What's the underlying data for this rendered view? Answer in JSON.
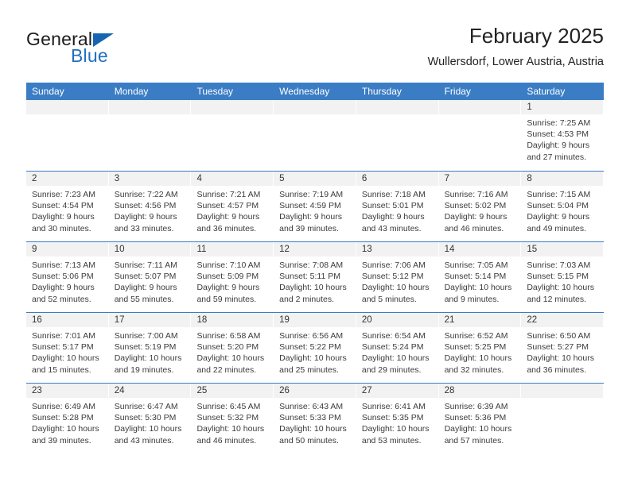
{
  "brand": {
    "name_primary": "General",
    "name_secondary": "Blue",
    "accent_color": "#1565b0"
  },
  "header": {
    "title": "February 2025",
    "subtitle": "Wullersdorf, Lower Austria, Austria"
  },
  "calendar": {
    "header_bg": "#3b7dc4",
    "daynum_bg": "#f2f2f2",
    "weekday_headers": [
      "Sunday",
      "Monday",
      "Tuesday",
      "Wednesday",
      "Thursday",
      "Friday",
      "Saturday"
    ],
    "weeks": [
      [
        {
          "date": "",
          "sunrise": "",
          "sunset": "",
          "daylight_line1": "",
          "daylight_line2": ""
        },
        {
          "date": "",
          "sunrise": "",
          "sunset": "",
          "daylight_line1": "",
          "daylight_line2": ""
        },
        {
          "date": "",
          "sunrise": "",
          "sunset": "",
          "daylight_line1": "",
          "daylight_line2": ""
        },
        {
          "date": "",
          "sunrise": "",
          "sunset": "",
          "daylight_line1": "",
          "daylight_line2": ""
        },
        {
          "date": "",
          "sunrise": "",
          "sunset": "",
          "daylight_line1": "",
          "daylight_line2": ""
        },
        {
          "date": "",
          "sunrise": "",
          "sunset": "",
          "daylight_line1": "",
          "daylight_line2": ""
        },
        {
          "date": "1",
          "sunrise": "Sunrise: 7:25 AM",
          "sunset": "Sunset: 4:53 PM",
          "daylight_line1": "Daylight: 9 hours",
          "daylight_line2": "and 27 minutes."
        }
      ],
      [
        {
          "date": "2",
          "sunrise": "Sunrise: 7:23 AM",
          "sunset": "Sunset: 4:54 PM",
          "daylight_line1": "Daylight: 9 hours",
          "daylight_line2": "and 30 minutes."
        },
        {
          "date": "3",
          "sunrise": "Sunrise: 7:22 AM",
          "sunset": "Sunset: 4:56 PM",
          "daylight_line1": "Daylight: 9 hours",
          "daylight_line2": "and 33 minutes."
        },
        {
          "date": "4",
          "sunrise": "Sunrise: 7:21 AM",
          "sunset": "Sunset: 4:57 PM",
          "daylight_line1": "Daylight: 9 hours",
          "daylight_line2": "and 36 minutes."
        },
        {
          "date": "5",
          "sunrise": "Sunrise: 7:19 AM",
          "sunset": "Sunset: 4:59 PM",
          "daylight_line1": "Daylight: 9 hours",
          "daylight_line2": "and 39 minutes."
        },
        {
          "date": "6",
          "sunrise": "Sunrise: 7:18 AM",
          "sunset": "Sunset: 5:01 PM",
          "daylight_line1": "Daylight: 9 hours",
          "daylight_line2": "and 43 minutes."
        },
        {
          "date": "7",
          "sunrise": "Sunrise: 7:16 AM",
          "sunset": "Sunset: 5:02 PM",
          "daylight_line1": "Daylight: 9 hours",
          "daylight_line2": "and 46 minutes."
        },
        {
          "date": "8",
          "sunrise": "Sunrise: 7:15 AM",
          "sunset": "Sunset: 5:04 PM",
          "daylight_line1": "Daylight: 9 hours",
          "daylight_line2": "and 49 minutes."
        }
      ],
      [
        {
          "date": "9",
          "sunrise": "Sunrise: 7:13 AM",
          "sunset": "Sunset: 5:06 PM",
          "daylight_line1": "Daylight: 9 hours",
          "daylight_line2": "and 52 minutes."
        },
        {
          "date": "10",
          "sunrise": "Sunrise: 7:11 AM",
          "sunset": "Sunset: 5:07 PM",
          "daylight_line1": "Daylight: 9 hours",
          "daylight_line2": "and 55 minutes."
        },
        {
          "date": "11",
          "sunrise": "Sunrise: 7:10 AM",
          "sunset": "Sunset: 5:09 PM",
          "daylight_line1": "Daylight: 9 hours",
          "daylight_line2": "and 59 minutes."
        },
        {
          "date": "12",
          "sunrise": "Sunrise: 7:08 AM",
          "sunset": "Sunset: 5:11 PM",
          "daylight_line1": "Daylight: 10 hours",
          "daylight_line2": "and 2 minutes."
        },
        {
          "date": "13",
          "sunrise": "Sunrise: 7:06 AM",
          "sunset": "Sunset: 5:12 PM",
          "daylight_line1": "Daylight: 10 hours",
          "daylight_line2": "and 5 minutes."
        },
        {
          "date": "14",
          "sunrise": "Sunrise: 7:05 AM",
          "sunset": "Sunset: 5:14 PM",
          "daylight_line1": "Daylight: 10 hours",
          "daylight_line2": "and 9 minutes."
        },
        {
          "date": "15",
          "sunrise": "Sunrise: 7:03 AM",
          "sunset": "Sunset: 5:15 PM",
          "daylight_line1": "Daylight: 10 hours",
          "daylight_line2": "and 12 minutes."
        }
      ],
      [
        {
          "date": "16",
          "sunrise": "Sunrise: 7:01 AM",
          "sunset": "Sunset: 5:17 PM",
          "daylight_line1": "Daylight: 10 hours",
          "daylight_line2": "and 15 minutes."
        },
        {
          "date": "17",
          "sunrise": "Sunrise: 7:00 AM",
          "sunset": "Sunset: 5:19 PM",
          "daylight_line1": "Daylight: 10 hours",
          "daylight_line2": "and 19 minutes."
        },
        {
          "date": "18",
          "sunrise": "Sunrise: 6:58 AM",
          "sunset": "Sunset: 5:20 PM",
          "daylight_line1": "Daylight: 10 hours",
          "daylight_line2": "and 22 minutes."
        },
        {
          "date": "19",
          "sunrise": "Sunrise: 6:56 AM",
          "sunset": "Sunset: 5:22 PM",
          "daylight_line1": "Daylight: 10 hours",
          "daylight_line2": "and 25 minutes."
        },
        {
          "date": "20",
          "sunrise": "Sunrise: 6:54 AM",
          "sunset": "Sunset: 5:24 PM",
          "daylight_line1": "Daylight: 10 hours",
          "daylight_line2": "and 29 minutes."
        },
        {
          "date": "21",
          "sunrise": "Sunrise: 6:52 AM",
          "sunset": "Sunset: 5:25 PM",
          "daylight_line1": "Daylight: 10 hours",
          "daylight_line2": "and 32 minutes."
        },
        {
          "date": "22",
          "sunrise": "Sunrise: 6:50 AM",
          "sunset": "Sunset: 5:27 PM",
          "daylight_line1": "Daylight: 10 hours",
          "daylight_line2": "and 36 minutes."
        }
      ],
      [
        {
          "date": "23",
          "sunrise": "Sunrise: 6:49 AM",
          "sunset": "Sunset: 5:28 PM",
          "daylight_line1": "Daylight: 10 hours",
          "daylight_line2": "and 39 minutes."
        },
        {
          "date": "24",
          "sunrise": "Sunrise: 6:47 AM",
          "sunset": "Sunset: 5:30 PM",
          "daylight_line1": "Daylight: 10 hours",
          "daylight_line2": "and 43 minutes."
        },
        {
          "date": "25",
          "sunrise": "Sunrise: 6:45 AM",
          "sunset": "Sunset: 5:32 PM",
          "daylight_line1": "Daylight: 10 hours",
          "daylight_line2": "and 46 minutes."
        },
        {
          "date": "26",
          "sunrise": "Sunrise: 6:43 AM",
          "sunset": "Sunset: 5:33 PM",
          "daylight_line1": "Daylight: 10 hours",
          "daylight_line2": "and 50 minutes."
        },
        {
          "date": "27",
          "sunrise": "Sunrise: 6:41 AM",
          "sunset": "Sunset: 5:35 PM",
          "daylight_line1": "Daylight: 10 hours",
          "daylight_line2": "and 53 minutes."
        },
        {
          "date": "28",
          "sunrise": "Sunrise: 6:39 AM",
          "sunset": "Sunset: 5:36 PM",
          "daylight_line1": "Daylight: 10 hours",
          "daylight_line2": "and 57 minutes."
        },
        {
          "date": "",
          "sunrise": "",
          "sunset": "",
          "daylight_line1": "",
          "daylight_line2": ""
        }
      ]
    ]
  }
}
